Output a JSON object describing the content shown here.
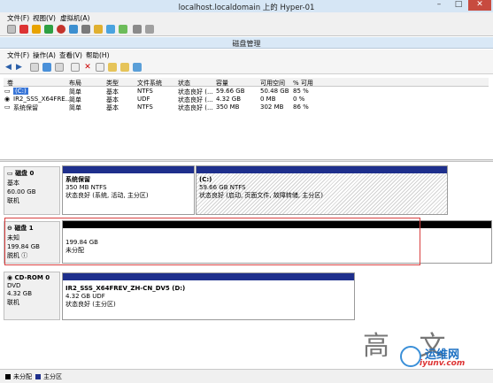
{
  "window": {
    "title": "localhost.localdomain 上的 Hyper-01",
    "menu": [
      "文件(F)",
      "视图(V)",
      "虚拟机(A)"
    ]
  },
  "disk_mgmt": {
    "title": "磁盘管理",
    "menu": [
      "文件(F)",
      "操作(A)",
      "查看(V)",
      "帮助(H)"
    ]
  },
  "volumes": {
    "headers": [
      "卷",
      "布局",
      "类型",
      "文件系统",
      "状态",
      "容量",
      "可用空间",
      "% 可用"
    ],
    "rows": [
      [
        "(C:)",
        "简单",
        "基本",
        "NTFS",
        "状态良好 (...",
        "59.66 GB",
        "50.48 GB",
        "85 %"
      ],
      [
        "IR2_SSS_X64FRE...",
        "简单",
        "基本",
        "UDF",
        "状态良好 (...",
        "4.32 GB",
        "0 MB",
        "0 %"
      ],
      [
        "系统保留",
        "简单",
        "基本",
        "NTFS",
        "状态良好 (...",
        "350 MB",
        "302 MB",
        "86 %"
      ]
    ]
  },
  "disks": [
    {
      "name": "磁盘 0",
      "type": "基本",
      "size": "60.00 GB",
      "status": "联机",
      "partitions": [
        {
          "title": "系统保留",
          "size": "350 MB NTFS",
          "status": "状态良好 (系统, 活动, 主分区)"
        },
        {
          "title": "(C:)",
          "size": "59.66 GB NTFS",
          "status": "状态良好 (启动, 页面文件, 故障转储, 主分区)"
        }
      ]
    },
    {
      "name": "磁盘 1",
      "type": "未知",
      "size": "199.84 GB",
      "status": "脱机",
      "partitions": [
        {
          "title": "",
          "size": "199.84 GB",
          "status": "未分配"
        }
      ]
    },
    {
      "name": "CD-ROM 0",
      "type": "DVD",
      "size": "4.32 GB",
      "status": "联机",
      "partitions": [
        {
          "title": "IR2_SSS_X64FREV_ZH-CN_DV5  (D:)",
          "size": "4.32 GB UDF",
          "status": "状态良好 (主分区)"
        }
      ]
    }
  ],
  "legend": [
    "未分配",
    "主分区"
  ],
  "watermark": {
    "chars": "高 文 本",
    "cn": "运维网",
    "url": "iyunv.com"
  },
  "colors": {
    "primary": "#1e2f8c",
    "unallocated": "#000000",
    "selection": "#3875d7",
    "highlight_box": "#d84040"
  }
}
